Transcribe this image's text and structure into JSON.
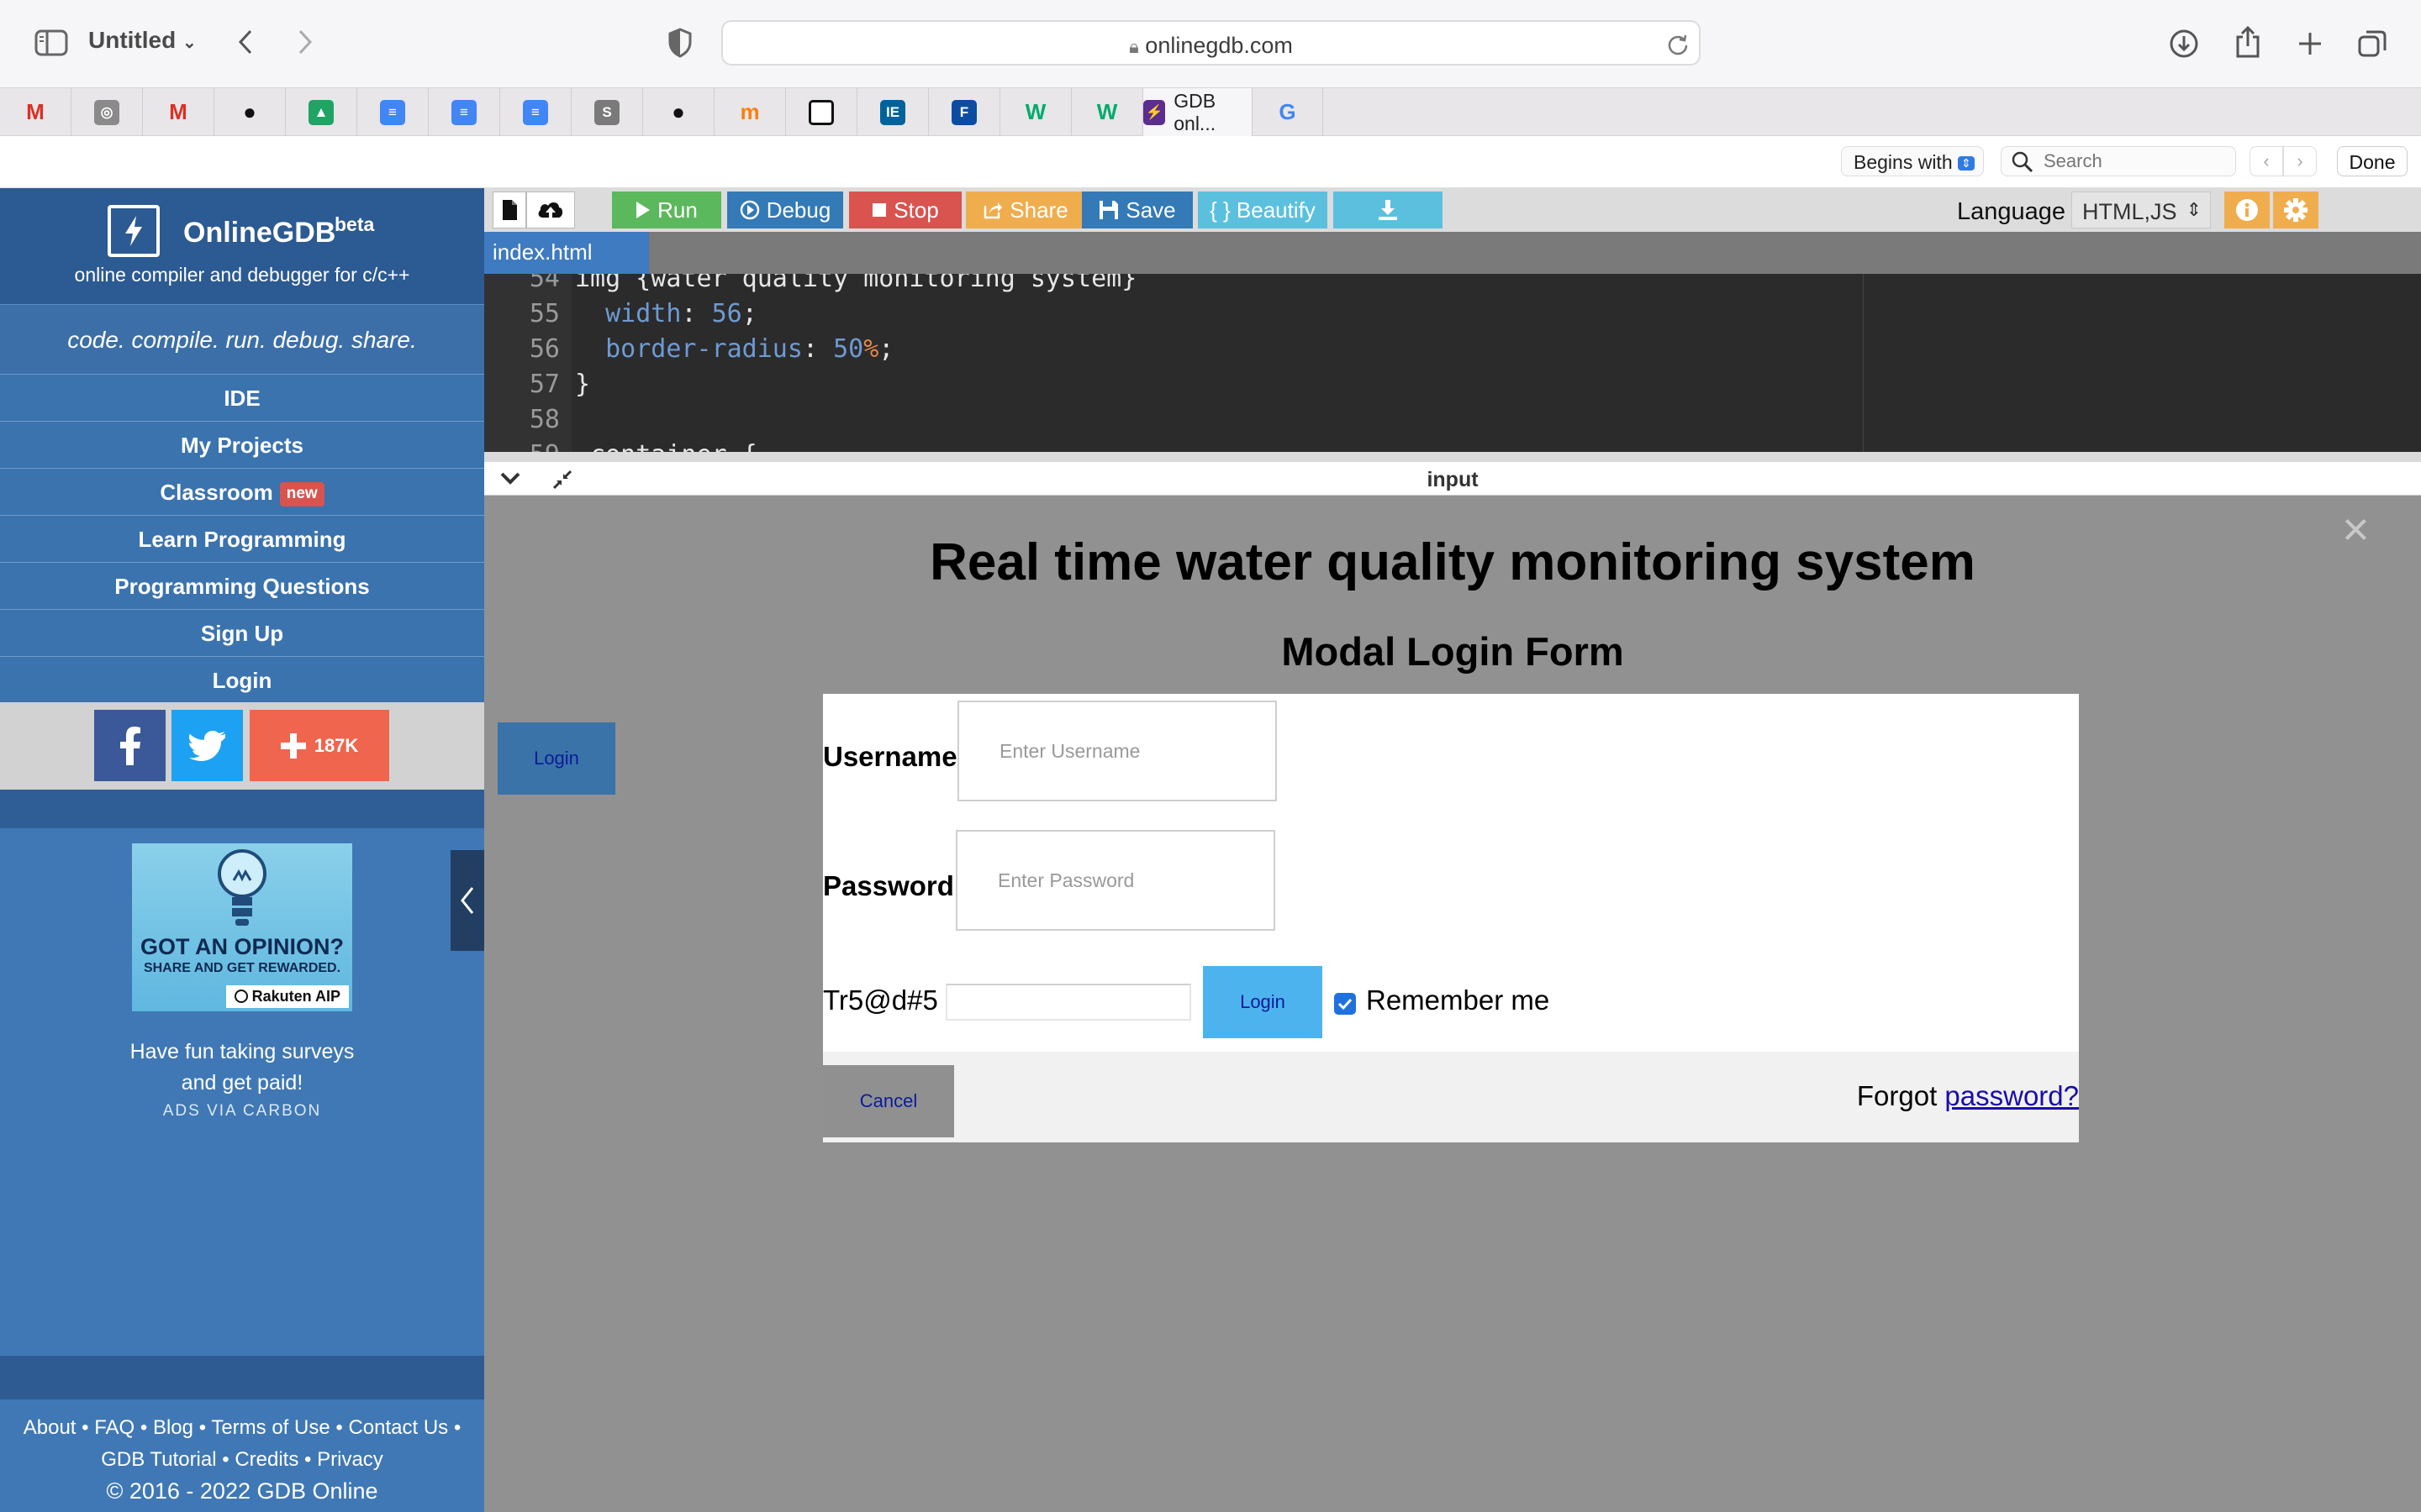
{
  "browser": {
    "window_title": "Untitled",
    "address": "onlinegdb.com",
    "tabs": [
      {
        "icon": "gmail-icon",
        "label": "",
        "color": "#d93025"
      },
      {
        "icon": "seal-icon",
        "label": "",
        "color": "#8a8a8a"
      },
      {
        "icon": "gmail-icon",
        "label": "",
        "color": "#d93025"
      },
      {
        "icon": "github-icon",
        "label": "",
        "color": "#111111"
      },
      {
        "icon": "google-drive-icon",
        "label": "",
        "color": "#1fa463"
      },
      {
        "icon": "google-docs-icon",
        "label": "",
        "color": "#4285f4"
      },
      {
        "icon": "google-docs-icon",
        "label": "",
        "color": "#4285f4"
      },
      {
        "icon": "google-docs-icon",
        "label": "",
        "color": "#4285f4"
      },
      {
        "icon": "s-icon",
        "label": "",
        "color": "#7a7a7a"
      },
      {
        "icon": "github-icon",
        "label": "",
        "color": "#111111"
      },
      {
        "icon": "moodle-icon",
        "label": "",
        "color": "#f98012"
      },
      {
        "icon": "square-icon",
        "label": "",
        "color": "#111111"
      },
      {
        "icon": "ieee-icon",
        "label": "",
        "color": "#00629b"
      },
      {
        "icon": "circle-f-icon",
        "label": "",
        "color": "#0c4da2"
      },
      {
        "icon": "w3schools-icon",
        "label": "",
        "color": "#04aa6d"
      },
      {
        "icon": "w3schools-icon",
        "label": "",
        "color": "#04aa6d"
      },
      {
        "icon": "onlinegdb-icon",
        "label": "GDB onl...",
        "color": "#5b2d8e"
      },
      {
        "icon": "google-icon",
        "label": "",
        "color": "#4285f4"
      }
    ],
    "find_bar": {
      "mode": "Begins with",
      "placeholder": "Search",
      "done_label": "Done"
    }
  },
  "sidebar": {
    "brand_name": "OnlineGDB",
    "brand_beta": "beta",
    "brand_desc": "online compiler and debugger for c/c++",
    "tagline": "code. compile. run. debug. share.",
    "nav": [
      {
        "label": "IDE"
      },
      {
        "label": "My Projects"
      },
      {
        "label": "Classroom",
        "badge": "new"
      },
      {
        "label": "Learn Programming"
      },
      {
        "label": "Programming Questions"
      },
      {
        "label": "Sign Up"
      },
      {
        "label": "Login"
      }
    ],
    "share_count": "187K",
    "ad": {
      "headline": "GOT AN OPINION?",
      "subline": "SHARE AND GET REWARDED.",
      "brand": "Rakuten AIP",
      "text_line1": "Have fun taking surveys",
      "text_line2": "and get paid!",
      "via": "ADS VIA CARBON"
    },
    "footer": {
      "links_line1": [
        "About",
        "FAQ",
        "Blog",
        "Terms of Use",
        "Contact Us"
      ],
      "links_line2": [
        "GDB Tutorial",
        "Credits",
        "Privacy"
      ],
      "separator": "•",
      "copyright": "© 2016 - 2022 GDB Online"
    }
  },
  "ide": {
    "toolbar": {
      "run": "Run",
      "debug": "Debug",
      "stop": "Stop",
      "share": "Share",
      "save": "Save",
      "beautify": "{ } Beautify",
      "language_label": "Language",
      "language_value": "HTML,JS"
    },
    "file_tab": "index.html",
    "editor_lines": [
      {
        "num": "54",
        "text": "img {water quality monitoring system}"
      },
      {
        "num": "55",
        "prop": "width",
        "value": "56",
        "suffix": ";"
      },
      {
        "num": "56",
        "prop": "border-radius",
        "value": "50",
        "unit": "%",
        "suffix": ";"
      },
      {
        "num": "57",
        "text": "}"
      },
      {
        "num": "58",
        "text": ""
      },
      {
        "num": "59",
        "text": " container {"
      }
    ],
    "io_title": "input"
  },
  "output": {
    "close": "×",
    "page_heading": "Real time water quality monitoring system",
    "modal_heading": "Modal Login Form",
    "open_login": "Login",
    "username_label": "Username",
    "username_placeholder": "Enter Username",
    "password_label": "Password",
    "password_placeholder": "Enter Password",
    "leaked_text": "Tr5@d#5",
    "submit_login": "Login",
    "remember_checked": true,
    "remember_label": "Remember me",
    "cancel": "Cancel",
    "forgot_text": "Forgot",
    "forgot_link": "password?"
  }
}
